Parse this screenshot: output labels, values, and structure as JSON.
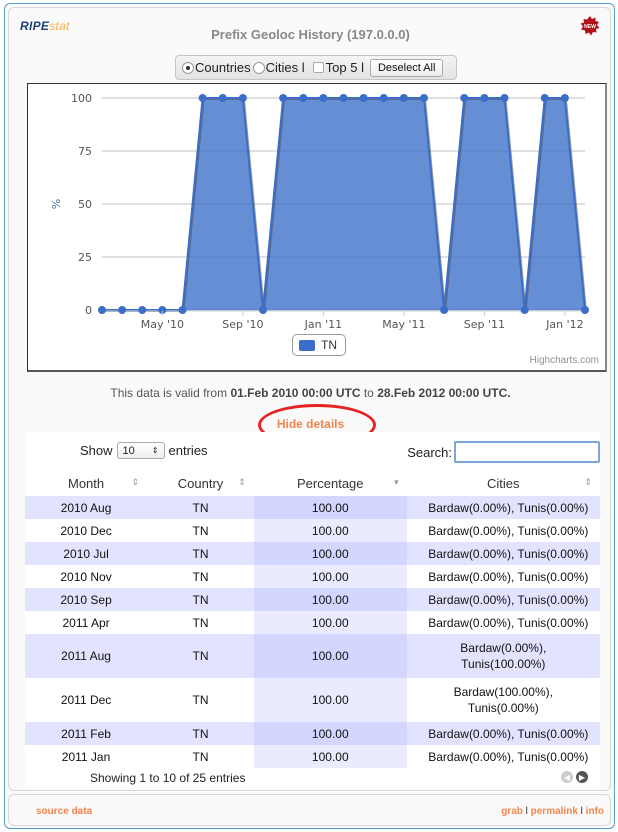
{
  "header": {
    "logo_ripe": "RIPE",
    "logo_stat": "stat",
    "title": "Prefix Geoloc History (197.0.0.0)",
    "new_badge": "NEW"
  },
  "controls": {
    "countries_label": "Countries",
    "countries_checked": true,
    "cities_label": "Cities l",
    "cities_checked": false,
    "top5_label": "Top 5 l",
    "top5_checked": false,
    "deselect_label": "Deselect All"
  },
  "chart_data": {
    "type": "area",
    "title": "",
    "xlabel": "",
    "ylabel": "%",
    "ylim": [
      0,
      100
    ],
    "yticks": [
      0,
      25,
      50,
      75,
      100
    ],
    "xtick_labels": [
      "May '10",
      "Sep '10",
      "Jan '11",
      "May '11",
      "Sep '11",
      "Jan '12"
    ],
    "xtick_month_index": [
      3,
      7,
      11,
      15,
      19,
      23
    ],
    "x": [
      "2010-02",
      "2010-03",
      "2010-04",
      "2010-05",
      "2010-06",
      "2010-07",
      "2010-08",
      "2010-09",
      "2010-10",
      "2010-11",
      "2010-12",
      "2011-01",
      "2011-02",
      "2011-03",
      "2011-04",
      "2011-05",
      "2011-06",
      "2011-07",
      "2011-08",
      "2011-09",
      "2011-10",
      "2011-11",
      "2011-12",
      "2012-01",
      "2012-02"
    ],
    "series": [
      {
        "name": "TN",
        "color": "#3b6ec9",
        "values": [
          0,
          0,
          0,
          0,
          0,
          100,
          100,
          100,
          0,
          100,
          100,
          100,
          100,
          100,
          100,
          100,
          100,
          0,
          100,
          100,
          100,
          0,
          100,
          100,
          0
        ]
      }
    ],
    "grid": true,
    "legend": "bottom-center",
    "credits": "Highcharts.com"
  },
  "validity": {
    "prefix": "This data is valid from ",
    "from": "01.Feb 2010 00:00 UTC",
    "mid": " to ",
    "to": "28.Feb 2012 00:00 UTC."
  },
  "hide_details_label": "Hide details",
  "table": {
    "show_label": "Show",
    "page_size": "10",
    "entries_label": "entries",
    "search_label": "Search:",
    "search_value": "",
    "columns": [
      "Month",
      "Country",
      "Percentage",
      "Cities"
    ],
    "rows": [
      {
        "month": "2010 Aug",
        "country": "TN",
        "percentage": "100.00",
        "cities": "Bardaw(0.00%), Tunis(0.00%)"
      },
      {
        "month": "2010 Dec",
        "country": "TN",
        "percentage": "100.00",
        "cities": "Bardaw(0.00%), Tunis(0.00%)"
      },
      {
        "month": "2010 Jul",
        "country": "TN",
        "percentage": "100.00",
        "cities": "Bardaw(0.00%), Tunis(0.00%)"
      },
      {
        "month": "2010 Nov",
        "country": "TN",
        "percentage": "100.00",
        "cities": "Bardaw(0.00%), Tunis(0.00%)"
      },
      {
        "month": "2010 Sep",
        "country": "TN",
        "percentage": "100.00",
        "cities": "Bardaw(0.00%), Tunis(0.00%)"
      },
      {
        "month": "2011 Apr",
        "country": "TN",
        "percentage": "100.00",
        "cities": "Bardaw(0.00%), Tunis(0.00%)"
      },
      {
        "month": "2011 Aug",
        "country": "TN",
        "percentage": "100.00",
        "cities": "Bardaw(0.00%), Tunis(100.00%)"
      },
      {
        "month": "2011 Dec",
        "country": "TN",
        "percentage": "100.00",
        "cities": "Bardaw(100.00%), Tunis(0.00%)"
      },
      {
        "month": "2011 Feb",
        "country": "TN",
        "percentage": "100.00",
        "cities": "Bardaw(0.00%), Tunis(0.00%)"
      },
      {
        "month": "2011 Jan",
        "country": "TN",
        "percentage": "100.00",
        "cities": "Bardaw(0.00%), Tunis(0.00%)"
      }
    ],
    "info": "Showing 1 to 10 of 25 entries"
  },
  "footer": {
    "source_data": "source data",
    "grab": "grab",
    "permalink": "permalink",
    "info": "info",
    "separator": " l "
  }
}
